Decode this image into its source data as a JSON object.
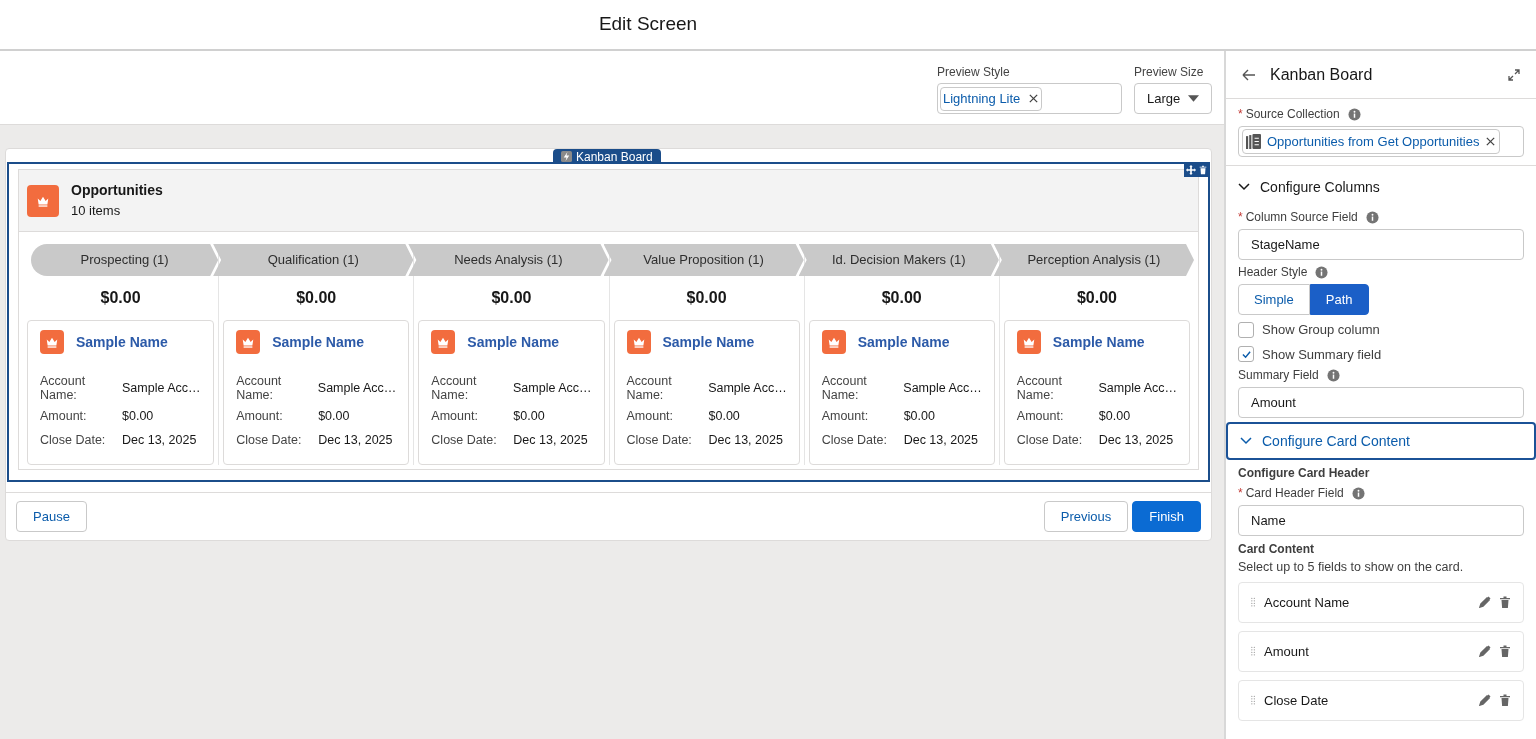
{
  "title": "Edit Screen",
  "preview": {
    "style_label": "Preview Style",
    "style_pill": "Lightning Lite",
    "size_label": "Preview Size",
    "size_value": "Large"
  },
  "component_tag": "Kanban Board",
  "board": {
    "title": "Opportunities",
    "subtitle": "10 items",
    "columns": [
      {
        "stage": "Prospecting (1)",
        "summary": "$0.00",
        "cards": [
          {
            "name": "Sample Name",
            "fields": [
              {
                "label": "Account Name:",
                "value": "Sample Acc…"
              },
              {
                "label": "Amount:",
                "value": "$0.00"
              },
              {
                "label": "Close Date:",
                "value": "Dec 13, 2025"
              }
            ]
          }
        ]
      },
      {
        "stage": "Qualification (1)",
        "summary": "$0.00",
        "cards": [
          {
            "name": "Sample Name",
            "fields": [
              {
                "label": "Account Name:",
                "value": "Sample Acc…"
              },
              {
                "label": "Amount:",
                "value": "$0.00"
              },
              {
                "label": "Close Date:",
                "value": "Dec 13, 2025"
              }
            ]
          }
        ]
      },
      {
        "stage": "Needs Analysis (1)",
        "summary": "$0.00",
        "cards": [
          {
            "name": "Sample Name",
            "fields": [
              {
                "label": "Account Name:",
                "value": "Sample Acc…"
              },
              {
                "label": "Amount:",
                "value": "$0.00"
              },
              {
                "label": "Close Date:",
                "value": "Dec 13, 2025"
              }
            ]
          }
        ]
      },
      {
        "stage": "Value Proposition (1)",
        "summary": "$0.00",
        "cards": [
          {
            "name": "Sample Name",
            "fields": [
              {
                "label": "Account Name:",
                "value": "Sample Acc…"
              },
              {
                "label": "Amount:",
                "value": "$0.00"
              },
              {
                "label": "Close Date:",
                "value": "Dec 13, 2025"
              }
            ]
          }
        ]
      },
      {
        "stage": "Id. Decision Makers (1)",
        "summary": "$0.00",
        "cards": [
          {
            "name": "Sample Name",
            "fields": [
              {
                "label": "Account Name:",
                "value": "Sample Acc…"
              },
              {
                "label": "Amount:",
                "value": "$0.00"
              },
              {
                "label": "Close Date:",
                "value": "Dec 13, 2025"
              }
            ]
          }
        ]
      },
      {
        "stage": "Perception Analysis (1)",
        "summary": "$0.00",
        "cards": [
          {
            "name": "Sample Name",
            "fields": [
              {
                "label": "Account Name:",
                "value": "Sample Acc…"
              },
              {
                "label": "Amount:",
                "value": "$0.00"
              },
              {
                "label": "Close Date:",
                "value": "Dec 13, 2025"
              }
            ]
          }
        ]
      }
    ]
  },
  "footer": {
    "left": [
      {
        "label": "Pause",
        "kind": "neutral"
      }
    ],
    "right": [
      {
        "label": "Previous",
        "kind": "neutral"
      },
      {
        "label": "Finish",
        "kind": "brand"
      }
    ]
  },
  "panel": {
    "title": "Kanban Board",
    "source": {
      "label": "Source Collection",
      "required_mark": "*",
      "pill": "Opportunities from Get Opportunities"
    },
    "sections": [
      {
        "title": "Configure Columns",
        "expanded": true,
        "selected": false,
        "items": [
          {
            "kind": "field",
            "label": "Column Source Field",
            "required_mark": "*",
            "value": "StageName"
          },
          {
            "kind": "segmented",
            "label": "Header Style",
            "options": [
              {
                "label": "Simple",
                "selected": false
              },
              {
                "label": "Path",
                "selected": true
              }
            ]
          },
          {
            "kind": "checkbox",
            "label": "Show Group column",
            "checked": false
          },
          {
            "kind": "checkbox",
            "label": "Show Summary field",
            "checked": true
          },
          {
            "kind": "field",
            "label": "Summary Field",
            "value": "Amount"
          }
        ]
      },
      {
        "title": "Configure Card Content",
        "expanded": true,
        "selected": true,
        "items": [
          {
            "kind": "heading",
            "text": "Configure Card Header"
          },
          {
            "kind": "field",
            "label": "Card Header Field",
            "required_mark": "*",
            "value": "Name"
          },
          {
            "kind": "heading",
            "text": "Card Content"
          },
          {
            "kind": "text",
            "text": "Select up to 5 fields to show on the card."
          },
          {
            "kind": "list",
            "entries": [
              "Account Name",
              "Amount",
              "Close Date"
            ]
          }
        ]
      }
    ]
  }
}
